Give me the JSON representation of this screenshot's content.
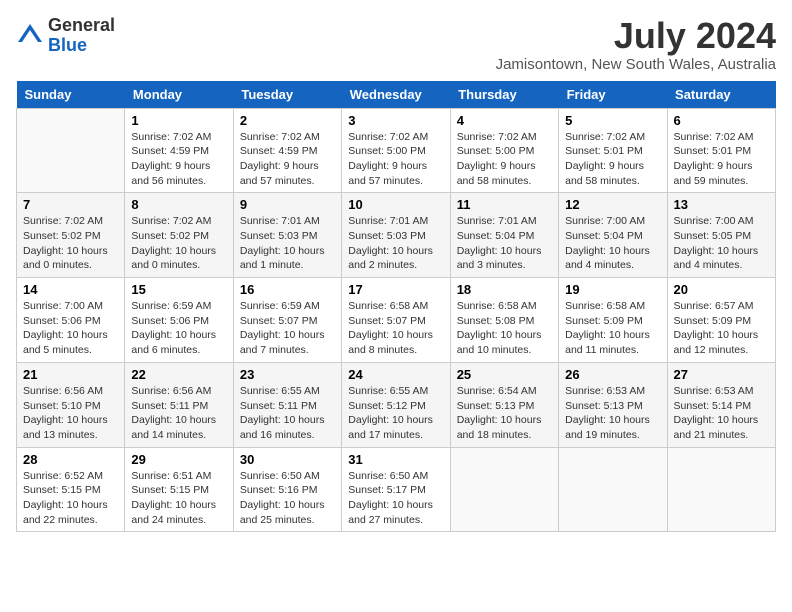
{
  "header": {
    "logo_general": "General",
    "logo_blue": "Blue",
    "month_title": "July 2024",
    "location": "Jamisontown, New South Wales, Australia"
  },
  "days_of_week": [
    "Sunday",
    "Monday",
    "Tuesday",
    "Wednesday",
    "Thursday",
    "Friday",
    "Saturday"
  ],
  "weeks": [
    [
      {
        "day": "",
        "sunrise": "",
        "sunset": "",
        "daylight": ""
      },
      {
        "day": "1",
        "sunrise": "Sunrise: 7:02 AM",
        "sunset": "Sunset: 4:59 PM",
        "daylight": "Daylight: 9 hours and 56 minutes."
      },
      {
        "day": "2",
        "sunrise": "Sunrise: 7:02 AM",
        "sunset": "Sunset: 4:59 PM",
        "daylight": "Daylight: 9 hours and 57 minutes."
      },
      {
        "day": "3",
        "sunrise": "Sunrise: 7:02 AM",
        "sunset": "Sunset: 5:00 PM",
        "daylight": "Daylight: 9 hours and 57 minutes."
      },
      {
        "day": "4",
        "sunrise": "Sunrise: 7:02 AM",
        "sunset": "Sunset: 5:00 PM",
        "daylight": "Daylight: 9 hours and 58 minutes."
      },
      {
        "day": "5",
        "sunrise": "Sunrise: 7:02 AM",
        "sunset": "Sunset: 5:01 PM",
        "daylight": "Daylight: 9 hours and 58 minutes."
      },
      {
        "day": "6",
        "sunrise": "Sunrise: 7:02 AM",
        "sunset": "Sunset: 5:01 PM",
        "daylight": "Daylight: 9 hours and 59 minutes."
      }
    ],
    [
      {
        "day": "7",
        "sunrise": "Sunrise: 7:02 AM",
        "sunset": "Sunset: 5:02 PM",
        "daylight": "Daylight: 10 hours and 0 minutes."
      },
      {
        "day": "8",
        "sunrise": "Sunrise: 7:02 AM",
        "sunset": "Sunset: 5:02 PM",
        "daylight": "Daylight: 10 hours and 0 minutes."
      },
      {
        "day": "9",
        "sunrise": "Sunrise: 7:01 AM",
        "sunset": "Sunset: 5:03 PM",
        "daylight": "Daylight: 10 hours and 1 minute."
      },
      {
        "day": "10",
        "sunrise": "Sunrise: 7:01 AM",
        "sunset": "Sunset: 5:03 PM",
        "daylight": "Daylight: 10 hours and 2 minutes."
      },
      {
        "day": "11",
        "sunrise": "Sunrise: 7:01 AM",
        "sunset": "Sunset: 5:04 PM",
        "daylight": "Daylight: 10 hours and 3 minutes."
      },
      {
        "day": "12",
        "sunrise": "Sunrise: 7:00 AM",
        "sunset": "Sunset: 5:04 PM",
        "daylight": "Daylight: 10 hours and 4 minutes."
      },
      {
        "day": "13",
        "sunrise": "Sunrise: 7:00 AM",
        "sunset": "Sunset: 5:05 PM",
        "daylight": "Daylight: 10 hours and 4 minutes."
      }
    ],
    [
      {
        "day": "14",
        "sunrise": "Sunrise: 7:00 AM",
        "sunset": "Sunset: 5:06 PM",
        "daylight": "Daylight: 10 hours and 5 minutes."
      },
      {
        "day": "15",
        "sunrise": "Sunrise: 6:59 AM",
        "sunset": "Sunset: 5:06 PM",
        "daylight": "Daylight: 10 hours and 6 minutes."
      },
      {
        "day": "16",
        "sunrise": "Sunrise: 6:59 AM",
        "sunset": "Sunset: 5:07 PM",
        "daylight": "Daylight: 10 hours and 7 minutes."
      },
      {
        "day": "17",
        "sunrise": "Sunrise: 6:58 AM",
        "sunset": "Sunset: 5:07 PM",
        "daylight": "Daylight: 10 hours and 8 minutes."
      },
      {
        "day": "18",
        "sunrise": "Sunrise: 6:58 AM",
        "sunset": "Sunset: 5:08 PM",
        "daylight": "Daylight: 10 hours and 10 minutes."
      },
      {
        "day": "19",
        "sunrise": "Sunrise: 6:58 AM",
        "sunset": "Sunset: 5:09 PM",
        "daylight": "Daylight: 10 hours and 11 minutes."
      },
      {
        "day": "20",
        "sunrise": "Sunrise: 6:57 AM",
        "sunset": "Sunset: 5:09 PM",
        "daylight": "Daylight: 10 hours and 12 minutes."
      }
    ],
    [
      {
        "day": "21",
        "sunrise": "Sunrise: 6:56 AM",
        "sunset": "Sunset: 5:10 PM",
        "daylight": "Daylight: 10 hours and 13 minutes."
      },
      {
        "day": "22",
        "sunrise": "Sunrise: 6:56 AM",
        "sunset": "Sunset: 5:11 PM",
        "daylight": "Daylight: 10 hours and 14 minutes."
      },
      {
        "day": "23",
        "sunrise": "Sunrise: 6:55 AM",
        "sunset": "Sunset: 5:11 PM",
        "daylight": "Daylight: 10 hours and 16 minutes."
      },
      {
        "day": "24",
        "sunrise": "Sunrise: 6:55 AM",
        "sunset": "Sunset: 5:12 PM",
        "daylight": "Daylight: 10 hours and 17 minutes."
      },
      {
        "day": "25",
        "sunrise": "Sunrise: 6:54 AM",
        "sunset": "Sunset: 5:13 PM",
        "daylight": "Daylight: 10 hours and 18 minutes."
      },
      {
        "day": "26",
        "sunrise": "Sunrise: 6:53 AM",
        "sunset": "Sunset: 5:13 PM",
        "daylight": "Daylight: 10 hours and 19 minutes."
      },
      {
        "day": "27",
        "sunrise": "Sunrise: 6:53 AM",
        "sunset": "Sunset: 5:14 PM",
        "daylight": "Daylight: 10 hours and 21 minutes."
      }
    ],
    [
      {
        "day": "28",
        "sunrise": "Sunrise: 6:52 AM",
        "sunset": "Sunset: 5:15 PM",
        "daylight": "Daylight: 10 hours and 22 minutes."
      },
      {
        "day": "29",
        "sunrise": "Sunrise: 6:51 AM",
        "sunset": "Sunset: 5:15 PM",
        "daylight": "Daylight: 10 hours and 24 minutes."
      },
      {
        "day": "30",
        "sunrise": "Sunrise: 6:50 AM",
        "sunset": "Sunset: 5:16 PM",
        "daylight": "Daylight: 10 hours and 25 minutes."
      },
      {
        "day": "31",
        "sunrise": "Sunrise: 6:50 AM",
        "sunset": "Sunset: 5:17 PM",
        "daylight": "Daylight: 10 hours and 27 minutes."
      },
      {
        "day": "",
        "sunrise": "",
        "sunset": "",
        "daylight": ""
      },
      {
        "day": "",
        "sunrise": "",
        "sunset": "",
        "daylight": ""
      },
      {
        "day": "",
        "sunrise": "",
        "sunset": "",
        "daylight": ""
      }
    ]
  ]
}
